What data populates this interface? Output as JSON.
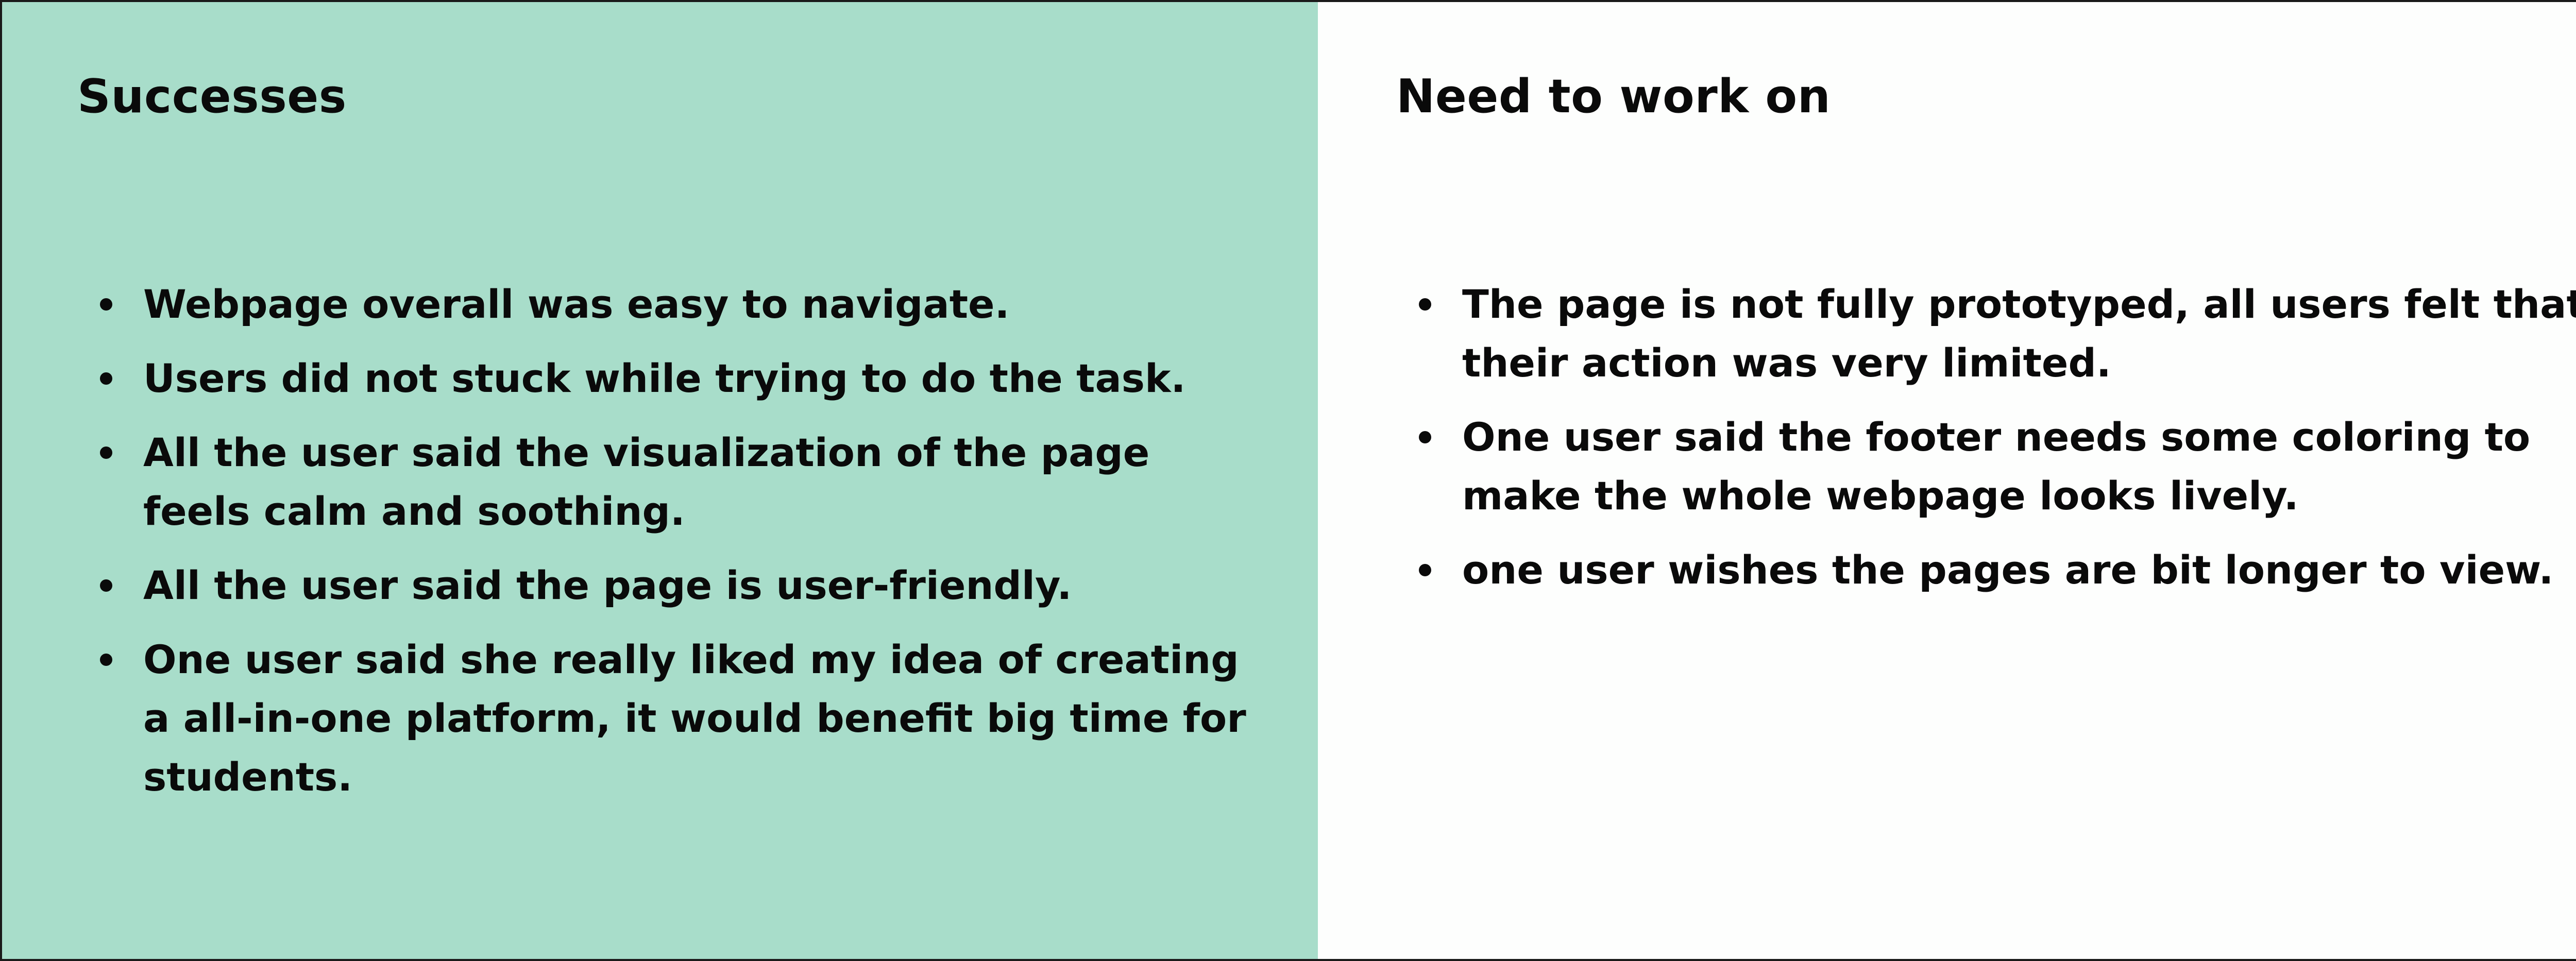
{
  "successes": {
    "title": "Successes",
    "items": [
      "Webpage overall was easy to navigate.",
      "Users did not stuck while trying to do the task.",
      "All the user said the visualization of the page feels calm and soothing.",
      "All the user said the page is user-friendly.",
      "One user said she really liked my idea of creating a all-in-one platform, it would benefit big time for students."
    ]
  },
  "needs_work": {
    "title": "Need to work on",
    "items": [
      "The page is not fully prototyped, all users felt that their action was very limited.",
      "One user said the footer needs some coloring to make the whole webpage looks lively.",
      "one user wishes the pages are bit longer to view."
    ]
  },
  "colors": {
    "successes_background": "#a8ddca",
    "needs_work_background": "#fdfefd",
    "text": "#0a0a0a"
  }
}
